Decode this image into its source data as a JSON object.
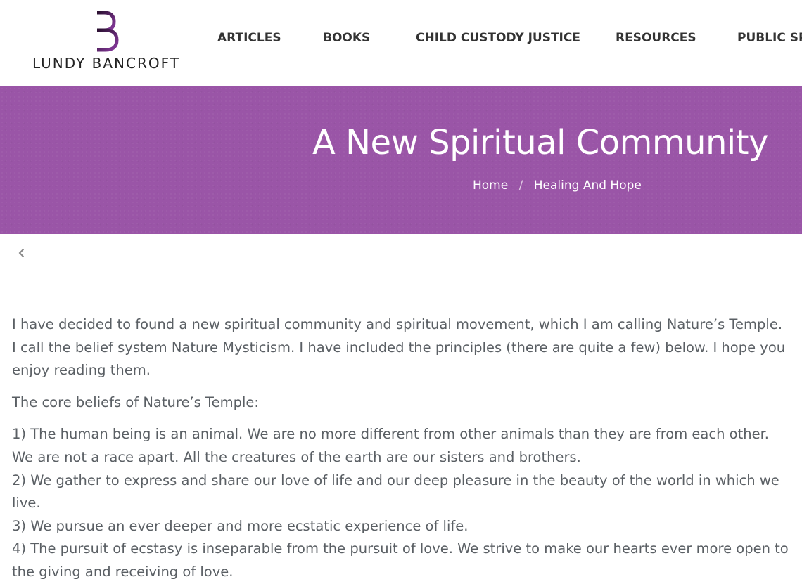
{
  "brand": {
    "name": "LUNDY BANCROFT",
    "accent": "#7a2f8c"
  },
  "nav": {
    "items": [
      {
        "label": "ARTICLES"
      },
      {
        "label": "BOOKS"
      },
      {
        "label": "CHILD CUSTODY JUSTICE"
      },
      {
        "label": "RESOURCES"
      },
      {
        "label": "PUBLIC SPI"
      }
    ]
  },
  "hero": {
    "title": "A New Spiritual Community",
    "breadcrumb": {
      "home": "Home",
      "separator": "/",
      "current": "Healing And Hope"
    },
    "background": "#9a55a7"
  },
  "back": {
    "icon": "chevron-left-icon"
  },
  "article": {
    "intro": "I have decided to found a new spiritual community and spiritual movement, which I am calling Nature’s Temple. I call the belief system Nature Mysticism. I have included the principles (there are quite a few) below. I hope you enjoy reading them.",
    "core_heading": "The core beliefs of Nature’s Temple:",
    "belief_1": "1) The human being is an animal. We are no more different from other animals than they are from each other. We are not a race apart. All the creatures of the earth are our sisters and brothers.",
    "belief_2": "2) We gather to express and share our love of life and our deep pleasure in the beauty of the world in which we live.",
    "belief_3": "3) We pursue an ever deeper and more ecstatic experience of life.",
    "belief_4": "4) The pursuit of ecstasy is inseparable from the pursuit of love. We strive to make our hearts ever more open to the giving and receiving of love."
  }
}
